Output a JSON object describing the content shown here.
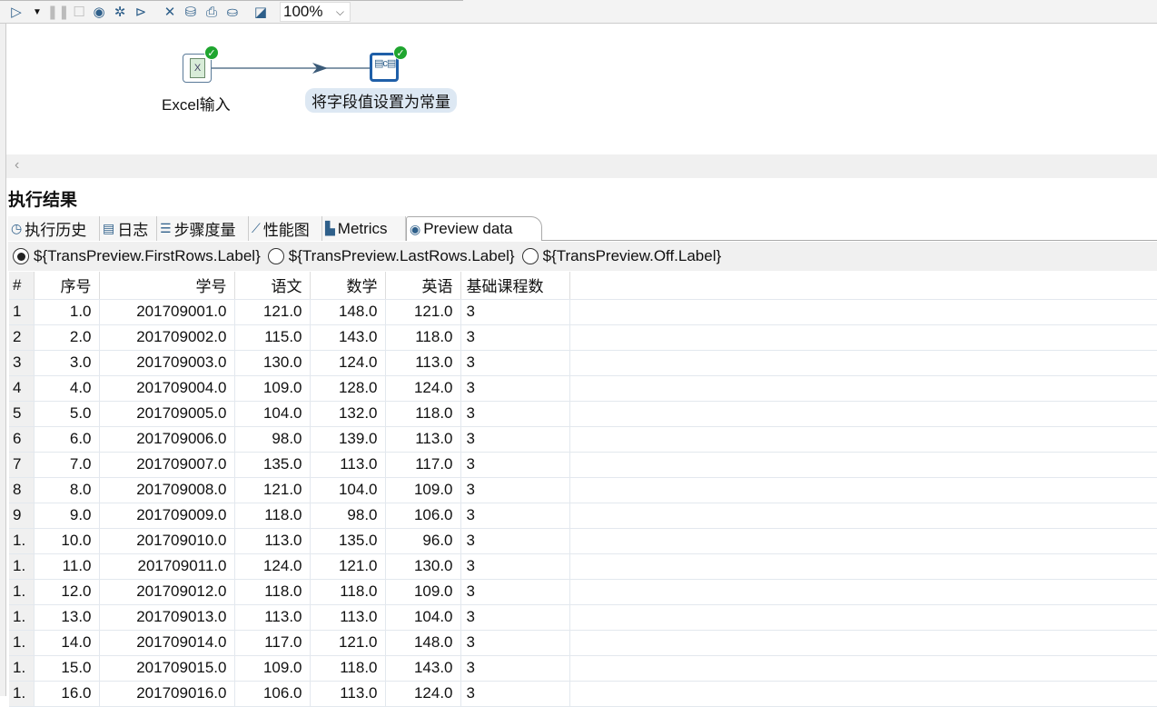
{
  "toolbar": {
    "zoom": "100%",
    "icons": [
      "run-icon",
      "run-dropdown-icon",
      "pause-icon",
      "stop-icon",
      "preview-icon",
      "debug-icon",
      "replay-icon",
      "verify-icon",
      "impact-icon",
      "sql-icon",
      "explore-db-icon",
      "results-panel-icon"
    ]
  },
  "canvas": {
    "steps": [
      {
        "label": "Excel输入"
      },
      {
        "label": "将字段值设置为常量"
      }
    ]
  },
  "results": {
    "title": "执行结果",
    "tabs": [
      "执行历史",
      "日志",
      "步骤度量",
      "性能图",
      "Metrics",
      "Preview data"
    ],
    "radios": [
      "${TransPreview.FirstRows.Label}",
      "${TransPreview.LastRows.Label}",
      "${TransPreview.Off.Label}"
    ],
    "columns": [
      "#",
      "序号",
      "学号",
      "语文",
      "数学",
      "英语",
      "基础课程数"
    ],
    "rows": [
      [
        "1",
        "1.0",
        "201709001.0",
        "121.0",
        "148.0",
        "121.0",
        "3"
      ],
      [
        "2",
        "2.0",
        "201709002.0",
        "115.0",
        "143.0",
        "118.0",
        "3"
      ],
      [
        "3",
        "3.0",
        "201709003.0",
        "130.0",
        "124.0",
        "113.0",
        "3"
      ],
      [
        "4",
        "4.0",
        "201709004.0",
        "109.0",
        "128.0",
        "124.0",
        "3"
      ],
      [
        "5",
        "5.0",
        "201709005.0",
        "104.0",
        "132.0",
        "118.0",
        "3"
      ],
      [
        "6",
        "6.0",
        "201709006.0",
        "98.0",
        "139.0",
        "113.0",
        "3"
      ],
      [
        "7",
        "7.0",
        "201709007.0",
        "135.0",
        "113.0",
        "117.0",
        "3"
      ],
      [
        "8",
        "8.0",
        "201709008.0",
        "121.0",
        "104.0",
        "109.0",
        "3"
      ],
      [
        "9",
        "9.0",
        "201709009.0",
        "118.0",
        "98.0",
        "106.0",
        "3"
      ],
      [
        "1.",
        "10.0",
        "201709010.0",
        "113.0",
        "135.0",
        "96.0",
        "3"
      ],
      [
        "1.",
        "11.0",
        "201709011.0",
        "124.0",
        "121.0",
        "130.0",
        "3"
      ],
      [
        "1.",
        "12.0",
        "201709012.0",
        "118.0",
        "118.0",
        "109.0",
        "3"
      ],
      [
        "1.",
        "13.0",
        "201709013.0",
        "113.0",
        "113.0",
        "104.0",
        "3"
      ],
      [
        "1.",
        "14.0",
        "201709014.0",
        "117.0",
        "121.0",
        "148.0",
        "3"
      ],
      [
        "1.",
        "15.0",
        "201709015.0",
        "109.0",
        "118.0",
        "143.0",
        "3"
      ],
      [
        "1.",
        "16.0",
        "201709016.0",
        "106.0",
        "113.0",
        "124.0",
        "3"
      ]
    ]
  }
}
